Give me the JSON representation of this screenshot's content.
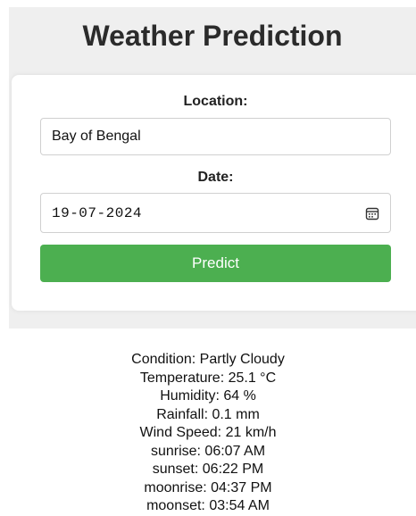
{
  "header": {
    "title": "Weather Prediction"
  },
  "form": {
    "location_label": "Location:",
    "location_value": "Bay of Bengal",
    "date_label": "Date:",
    "date_value": "19-07-2024",
    "date_icon": "calendar-icon",
    "predict_label": "Predict"
  },
  "results": {
    "condition": "Condition: Partly Cloudy",
    "temperature": "Temperature: 25.1 °C",
    "humidity": "Humidity: 64 %",
    "rainfall": "Rainfall: 0.1 mm",
    "wind_speed": "Wind Speed: 21 km/h",
    "sunrise": "sunrise: 06:07 AM",
    "sunset": "sunset: 06:22 PM",
    "moonrise": "moonrise: 04:37 PM",
    "moonset": "moonset: 03:54 AM"
  },
  "colors": {
    "button_bg": "#4caf50",
    "page_bg": "#efefef"
  }
}
